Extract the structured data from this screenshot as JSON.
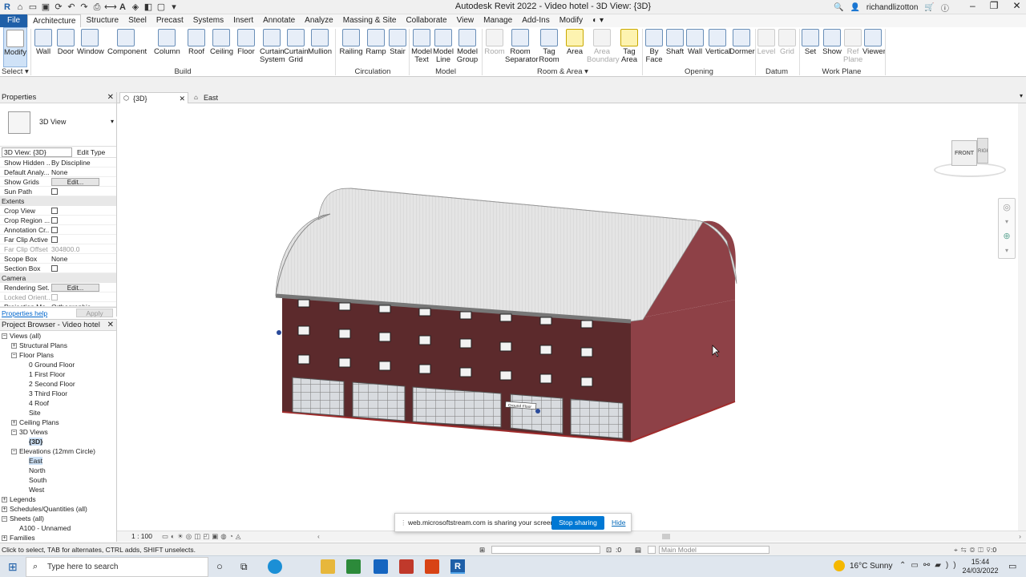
{
  "window": {
    "title": "Autodesk Revit 2022 - Video hotel - 3D View: {3D}",
    "user": "richandlizotton"
  },
  "tabs": [
    "File",
    "Architecture",
    "Structure",
    "Steel",
    "Precast",
    "Systems",
    "Insert",
    "Annotate",
    "Analyze",
    "Massing & Site",
    "Collaborate",
    "View",
    "Manage",
    "Add-Ins",
    "Modify"
  ],
  "ribbon": {
    "select": {
      "modify": "Modify",
      "select_label": "Select"
    },
    "build": [
      "Wall",
      "Door",
      "Window",
      "Component",
      "Column",
      "Roof",
      "Ceiling",
      "Floor",
      "Curtain System",
      "Curtain Grid",
      "Mullion"
    ],
    "circulation": [
      "Railing",
      "Ramp",
      "Stair"
    ],
    "model": [
      "Model Text",
      "Model Line",
      "Model Group"
    ],
    "room_area": [
      "Room",
      "Room Separator",
      "Tag Room",
      "Area",
      "Area Boundary",
      "Tag Area"
    ],
    "opening": [
      "By Face",
      "Shaft",
      "Wall",
      "Vertical",
      "Dormer"
    ],
    "datum": [
      "Level",
      "Grid"
    ],
    "work_plane": [
      "Set",
      "Show",
      "Ref Plane",
      "Viewer"
    ],
    "panels": {
      "build": "Build",
      "circulation": "Circulation",
      "model": "Model",
      "room_area": "Room & Area",
      "opening": "Opening",
      "datum": "Datum",
      "work_plane": "Work Plane"
    }
  },
  "properties": {
    "title": "Properties",
    "type_name": "3D View",
    "instance_selector": "3D View: {3D}",
    "edit_type": "Edit Type",
    "rows": [
      {
        "k": "Show Hidden ...",
        "v": "By Discipline"
      },
      {
        "k": "Default Analy...",
        "v": "None"
      },
      {
        "k": "Show Grids",
        "v": "Edit..."
      },
      {
        "k": "Sun Path",
        "v": ""
      }
    ],
    "extents_label": "Extents",
    "extents": [
      {
        "k": "Crop View",
        "v": ""
      },
      {
        "k": "Crop Region ...",
        "v": ""
      },
      {
        "k": "Annotation Cr...",
        "v": ""
      },
      {
        "k": "Far Clip Active",
        "v": ""
      },
      {
        "k": "Far Clip Offset",
        "v": "304800.0"
      },
      {
        "k": "Scope Box",
        "v": "None"
      },
      {
        "k": "Section Box",
        "v": ""
      }
    ],
    "camera_label": "Camera",
    "camera": [
      {
        "k": "Rendering Set...",
        "v": "Edit..."
      },
      {
        "k": "Locked Orient...",
        "v": ""
      },
      {
        "k": "Projection Mo...",
        "v": "Orthographic"
      }
    ],
    "help": "Properties help",
    "apply": "Apply"
  },
  "browser": {
    "title": "Project Browser - Video hotel",
    "items": [
      {
        "label": "Views (all)",
        "lvl": 0
      },
      {
        "label": "Structural Plans",
        "lvl": 1
      },
      {
        "label": "Floor Plans",
        "lvl": 1
      },
      {
        "label": "0 Ground Floor",
        "lvl": 2
      },
      {
        "label": "1 First Floor",
        "lvl": 2
      },
      {
        "label": "2 Second Floor",
        "lvl": 2
      },
      {
        "label": "3 Third Floor",
        "lvl": 2
      },
      {
        "label": "4 Roof",
        "lvl": 2
      },
      {
        "label": "Site",
        "lvl": 2
      },
      {
        "label": "Ceiling Plans",
        "lvl": 1
      },
      {
        "label": "3D Views",
        "lvl": 1
      },
      {
        "label": "{3D}",
        "lvl": 2
      },
      {
        "label": "Elevations (12mm Circle)",
        "lvl": 1
      },
      {
        "label": "East",
        "lvl": 2
      },
      {
        "label": "North",
        "lvl": 2
      },
      {
        "label": "South",
        "lvl": 2
      },
      {
        "label": "West",
        "lvl": 2
      },
      {
        "label": "Legends",
        "lvl": 0
      },
      {
        "label": "Schedules/Quantities (all)",
        "lvl": 0
      },
      {
        "label": "Sheets (all)",
        "lvl": 0
      },
      {
        "label": "A100 - Unnamed",
        "lvl": 1
      },
      {
        "label": "Families",
        "lvl": 0
      }
    ]
  },
  "doc_tabs": [
    "{3D}",
    "East"
  ],
  "viewcube": {
    "front": "FRONT",
    "right": "RIGHT"
  },
  "level_tag": "Ground Floor",
  "view_scale": "1 : 100",
  "status": {
    "hint": "Click to select, TAB for alternates, CTRL adds, SHIFT unselects.",
    "zero": ":0",
    "model": "Main Model"
  },
  "share": {
    "text": "web.microsoftstream.com is sharing your screen.",
    "stop": "Stop sharing",
    "hide": "Hide"
  },
  "taskbar": {
    "search": "Type here to search",
    "weather": "16°C  Sunny",
    "time": "15:44",
    "date": "24/03/2022"
  }
}
